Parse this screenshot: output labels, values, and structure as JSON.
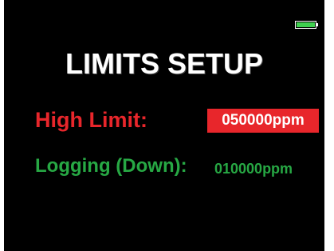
{
  "colors": {
    "background": "#000000",
    "title": "#ffffff",
    "high_limit": "#e8262b",
    "logging": "#27a844",
    "selection_box": "#e8262b",
    "selection_text": "#ffffff",
    "battery": "#3fd04f"
  },
  "status": {
    "battery_icon": "battery-full-icon",
    "battery_level": 1.0
  },
  "screen": {
    "title": "LIMITS SETUP"
  },
  "settings": {
    "high_limit": {
      "label": "High Limit:",
      "value": "050000ppm",
      "selected": true
    },
    "logging": {
      "label": "Logging (Down):",
      "value": "010000ppm",
      "selected": false
    }
  }
}
